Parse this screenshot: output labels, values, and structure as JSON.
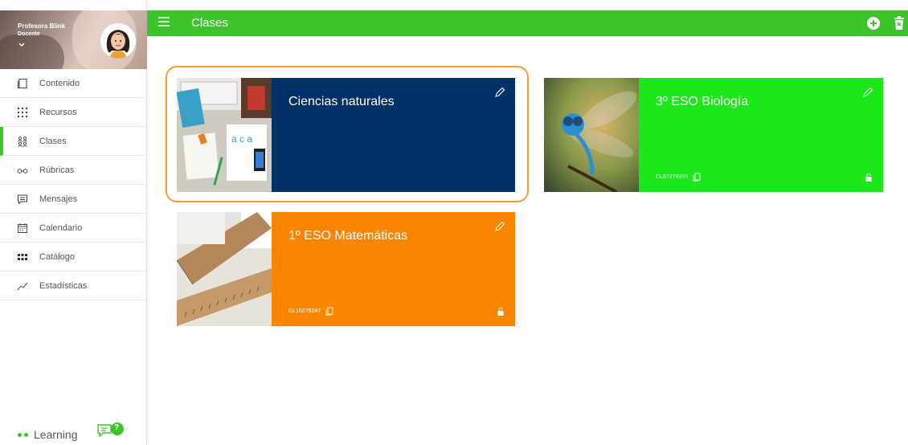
{
  "profile": {
    "name": "Profesora Blink",
    "role": "Docente"
  },
  "sidebar": {
    "items": [
      {
        "label": "Contenido",
        "icon": "content-icon",
        "active": false
      },
      {
        "label": "Recursos",
        "icon": "grid-dots-icon",
        "active": false
      },
      {
        "label": "Clases",
        "icon": "classes-icon",
        "active": true
      },
      {
        "label": "Rúbricas",
        "icon": "glasses-icon",
        "active": false
      },
      {
        "label": "Mensajes",
        "icon": "message-icon",
        "active": false
      },
      {
        "label": "Calendario",
        "icon": "calendar-icon",
        "active": false
      },
      {
        "label": "Catálogo",
        "icon": "catalog-icon",
        "active": false
      },
      {
        "label": "Estadísticas",
        "icon": "stats-icon",
        "active": false
      }
    ],
    "brand": "Learning",
    "help_badge": "?"
  },
  "header": {
    "title": "Clases"
  },
  "cards": [
    {
      "title": "Ciencias naturales",
      "code": "",
      "color": "#003269"
    },
    {
      "title": "3º ESO Biología",
      "code": "CL87278896",
      "color": "#1ae81a"
    },
    {
      "title": "1º ESO Matemáticas",
      "code": "CL16279247",
      "color": "#f98500"
    }
  ],
  "colors": {
    "accent": "#3dc42a",
    "highlight": "#f39c33"
  }
}
